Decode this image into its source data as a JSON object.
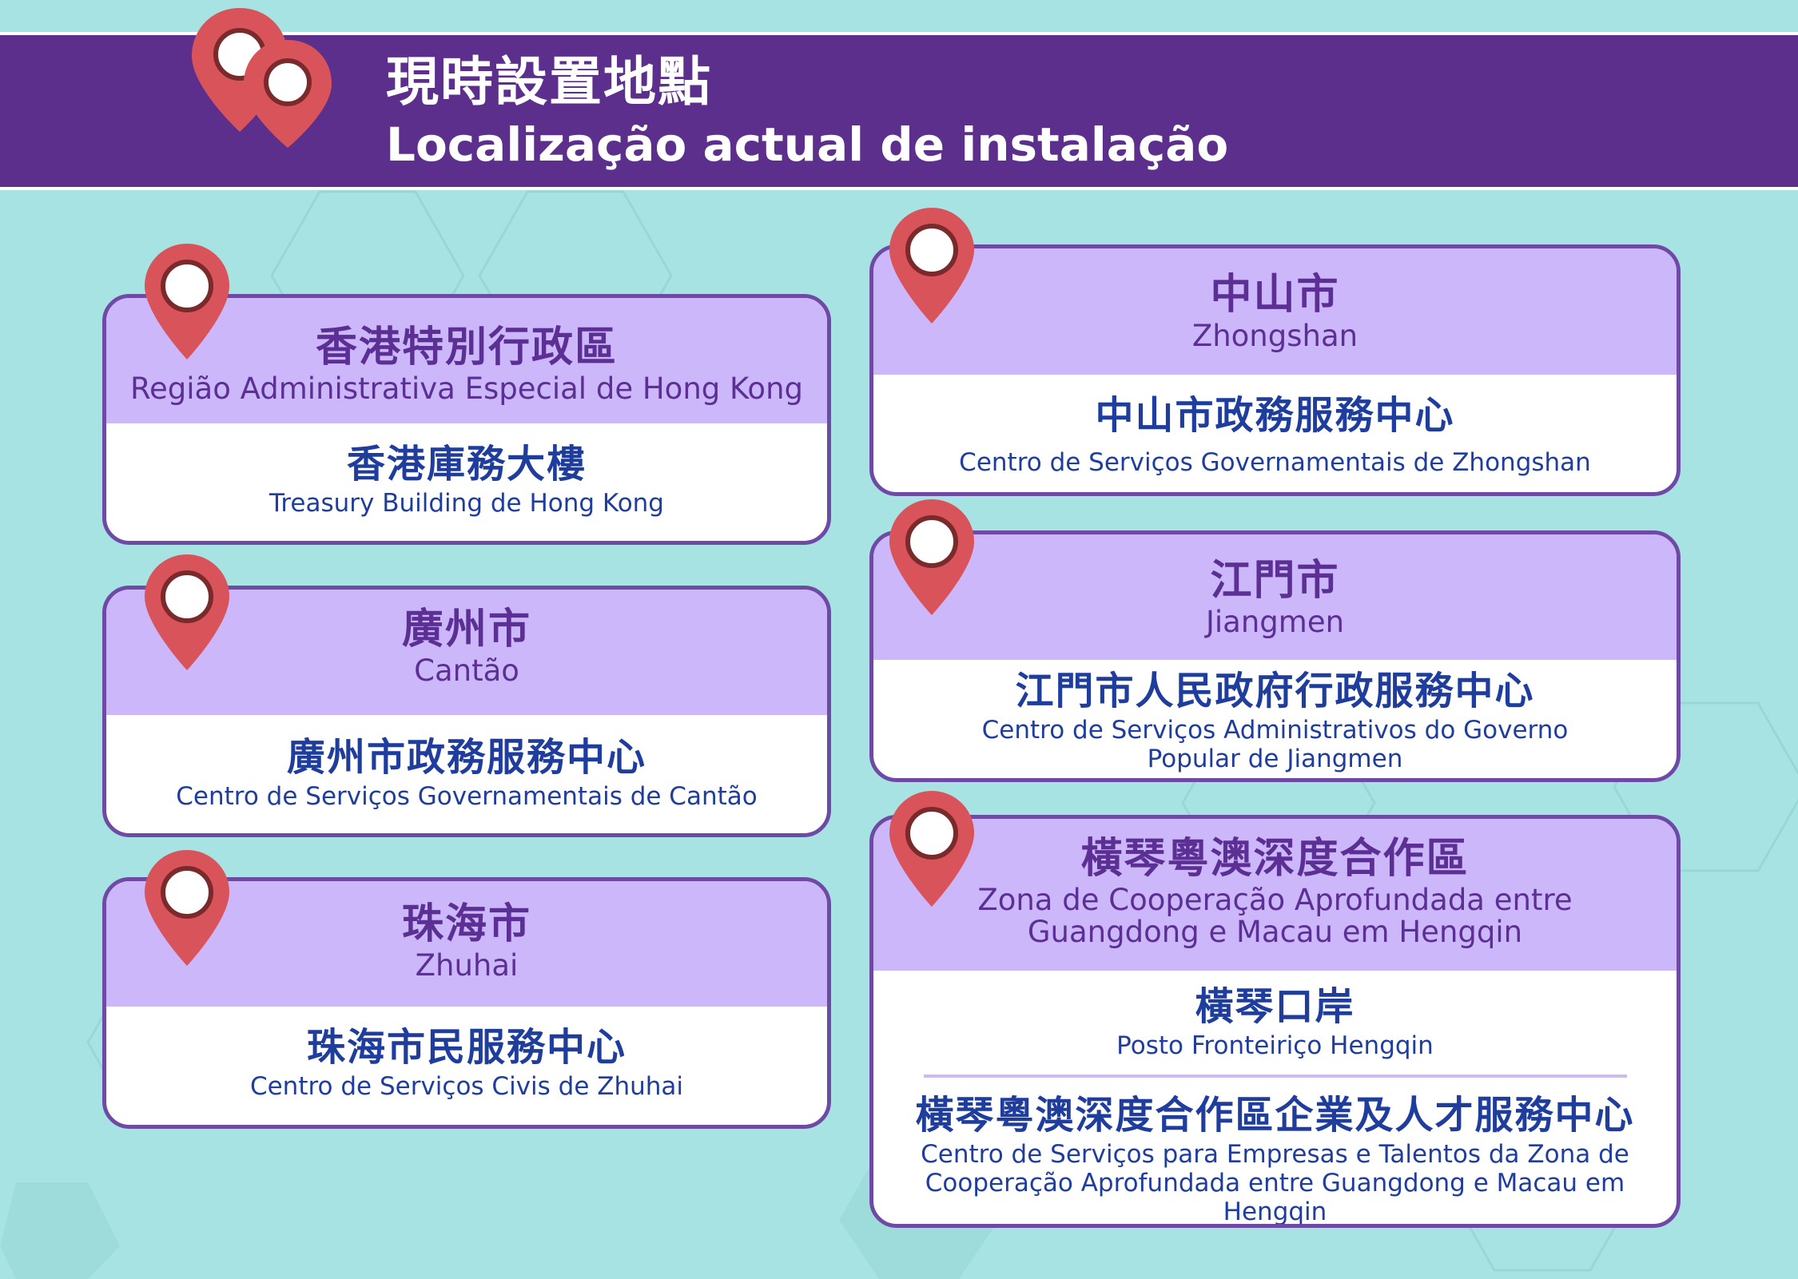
{
  "header": {
    "title_zh": "現時設置地點",
    "title_pt": "Localização actual de instalação"
  },
  "locations": [
    {
      "city_zh": "香港特別行政區",
      "city_pt": "Região Administrativa Especial de Hong Kong",
      "places": [
        {
          "name_zh": "香港庫務大樓",
          "name_pt": "Treasury Building de Hong Kong"
        }
      ]
    },
    {
      "city_zh": "廣州市",
      "city_pt": "Cantão",
      "places": [
        {
          "name_zh": "廣州市政務服務中心",
          "name_pt": "Centro de Serviços Governamentais de Cantão"
        }
      ]
    },
    {
      "city_zh": "珠海市",
      "city_pt": "Zhuhai",
      "places": [
        {
          "name_zh": "珠海市民服務中心",
          "name_pt": "Centro de Serviços Civis de Zhuhai"
        }
      ]
    },
    {
      "city_zh": "中山市",
      "city_pt": "Zhongshan",
      "places": [
        {
          "name_zh": "中山市政務服務中心",
          "name_pt": "Centro de Serviços Governamentais de Zhongshan"
        }
      ]
    },
    {
      "city_zh": "江門市",
      "city_pt": "Jiangmen",
      "places": [
        {
          "name_zh": "江門市人民政府行政服務中心",
          "name_pt_line1": "Centro de Serviços Administrativos do Governo",
          "name_pt_line2": "Popular de Jiangmen"
        }
      ]
    },
    {
      "city_zh": "橫琴粵澳深度合作區",
      "city_pt_line1": "Zona de Cooperação Aprofundada entre",
      "city_pt_line2": "Guangdong e Macau em Hengqin",
      "places": [
        {
          "name_zh": "橫琴口岸",
          "name_pt": "Posto Fronteiriço Hengqin"
        },
        {
          "name_zh": "橫琴粵澳深度合作區企業及人才服務中心",
          "name_pt_line1": "Centro de Serviços para Empresas e Talentos da Zona de",
          "name_pt_line2": "Cooperação Aprofundada entre Guangdong e Macau em Hengqin"
        }
      ]
    }
  ],
  "colors": {
    "background": "#a6e3e2",
    "header_band": "#5d2f8c",
    "card_header": "#ccb7fb",
    "card_border": "#6f4aa5",
    "pin": "#d9545a",
    "city_text": "#5b2f94",
    "location_text": "#1f3d9c"
  },
  "icons": [
    "map-pin-icon"
  ]
}
